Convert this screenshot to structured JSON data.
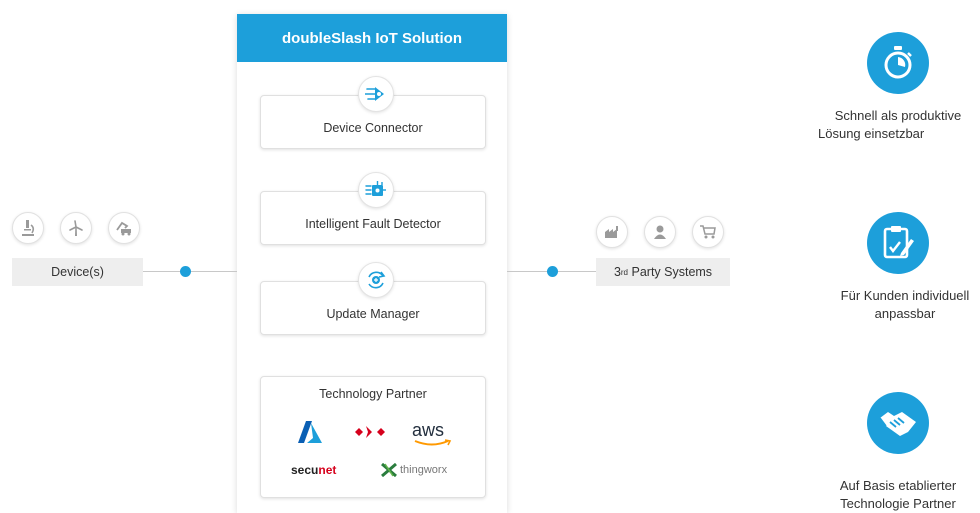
{
  "solution": {
    "title": "doubleSlash IoT Solution",
    "modules": [
      {
        "label": "Device Connector",
        "icon": "device-connector-icon"
      },
      {
        "label": "Intelligent Fault Detector",
        "icon": "fault-detector-icon"
      },
      {
        "label": "Update Manager",
        "icon": "update-manager-icon"
      }
    ],
    "partner": {
      "title": "Technology Partner",
      "logos": [
        "azure-logo",
        "red-arrows-logo",
        "aws",
        "secu",
        "net",
        "thingworx"
      ]
    }
  },
  "devices": {
    "label": "Device(s)",
    "icons": [
      "microscope-icon",
      "wind-turbine-icon",
      "construction-vehicle-icon"
    ]
  },
  "third_party": {
    "label_main": "3",
    "label_sup": "rd",
    "label_rest": " Party Systems",
    "icons": [
      "factory-icon",
      "person-icon",
      "shopping-cart-icon"
    ]
  },
  "benefits": [
    {
      "icon": "stopwatch-icon",
      "line1": "Schnell als produktive",
      "line2": "Lösung einsetzbar"
    },
    {
      "icon": "clipboard-edit-icon",
      "line1": "Für Kunden individuell",
      "line2": "anpassbar"
    },
    {
      "icon": "handshake-icon",
      "line1": "Auf Basis etablierter",
      "line2": "Technologie Partner"
    }
  ],
  "colors": {
    "accent": "#1d9fda",
    "label_bg": "#eeeeee",
    "secunet_red": "#d6001c"
  }
}
